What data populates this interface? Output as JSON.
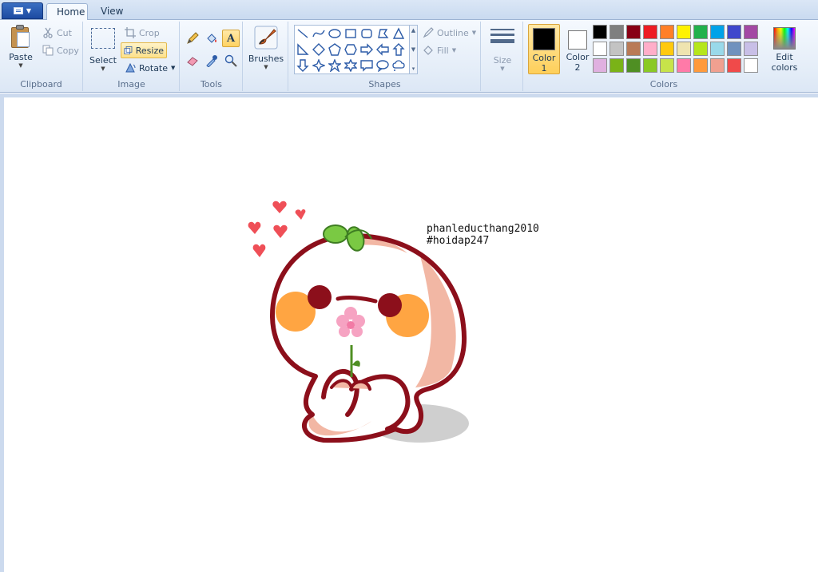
{
  "tabs": [
    {
      "label": "Home",
      "active": true
    },
    {
      "label": "View",
      "active": false
    }
  ],
  "clipboard": {
    "paste_label": "Paste",
    "cut_label": "Cut",
    "copy_label": "Copy",
    "group_label": "Clipboard"
  },
  "image": {
    "select_label": "Select",
    "crop_label": "Crop",
    "resize_label": "Resize",
    "rotate_label": "Rotate",
    "group_label": "Image"
  },
  "tools": {
    "group_label": "Tools",
    "items": [
      {
        "name": "pencil-icon",
        "active": false
      },
      {
        "name": "fill-bucket-icon",
        "active": false
      },
      {
        "name": "text-icon",
        "glyph": "A",
        "active": true
      },
      {
        "name": "eraser-icon",
        "active": false
      },
      {
        "name": "color-picker-icon",
        "active": false
      },
      {
        "name": "magnifier-icon",
        "active": false
      }
    ]
  },
  "brushes": {
    "label": "Brushes"
  },
  "shapes": {
    "group_label": "Shapes",
    "outline_label": "Outline",
    "fill_label": "Fill"
  },
  "size": {
    "label": "Size"
  },
  "colors": {
    "group_label": "Colors",
    "color1_label": "Color 1",
    "color1_value": "#000000",
    "color2_label": "Color 2",
    "color2_value": "#ffffff",
    "edit_label": "Edit colors",
    "palette": [
      "#000000",
      "#7f7f7f",
      "#880015",
      "#ed1c24",
      "#ff7f27",
      "#fff200",
      "#22b14c",
      "#00a2e8",
      "#3f48cc",
      "#a349a4",
      "#ffffff",
      "#c3c3c3",
      "#b97a57",
      "#ffaec9",
      "#ffc90e",
      "#efe4b0",
      "#b5e61d",
      "#99d9ea",
      "#7092be",
      "#c8bfe7",
      "#e0b0e0",
      "#7ab317",
      "#4f8f23",
      "#8ac926",
      "#c7e34a",
      "#ff7aa8",
      "#ff9a3c",
      "#f0a090",
      "#f04a4a",
      "#ffffff"
    ]
  },
  "canvas": {
    "caption_line1": "phanleducthang2010",
    "caption_line2": "#hoidap247"
  }
}
